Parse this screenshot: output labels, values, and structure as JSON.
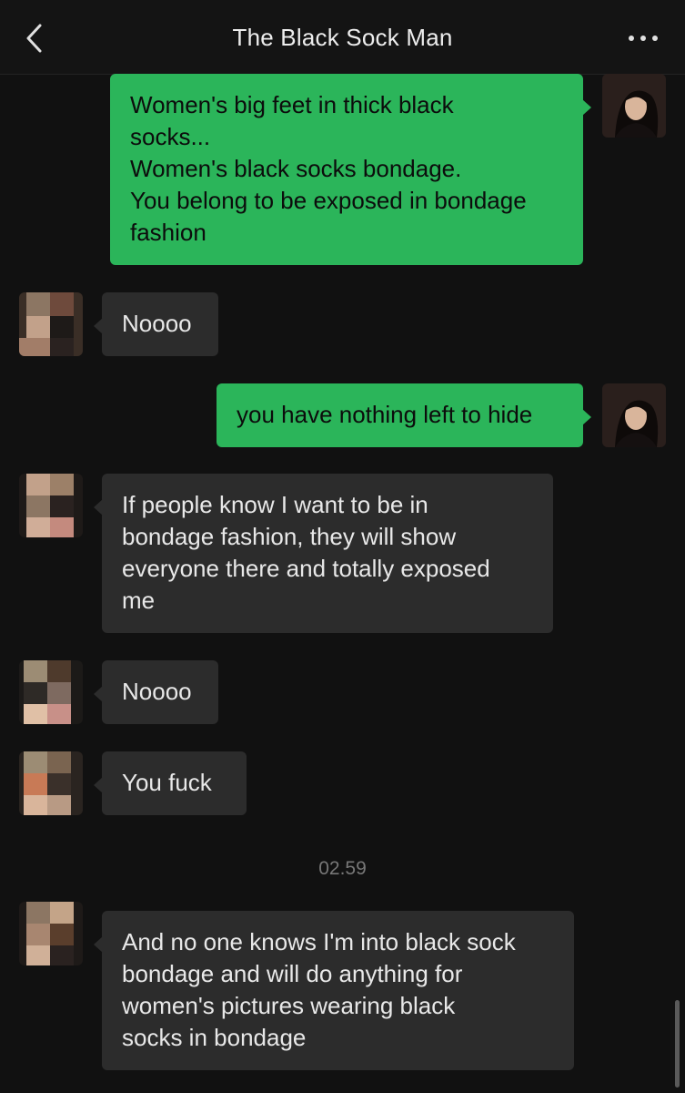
{
  "header": {
    "title": "The Black Sock Man",
    "back_icon": "chevron-left-icon",
    "more_icon": "more-horizontal-icon"
  },
  "colors": {
    "outgoing_bubble": "#2bb55a",
    "incoming_bubble": "#2c2c2c",
    "background": "#111111"
  },
  "messages": [
    {
      "direction": "out",
      "text": "Women's big feet in thick black\nsocks...\nWomen's black socks bondage.\nYou belong to be exposed in bondage\nfashion"
    },
    {
      "direction": "in",
      "text": "Noooo"
    },
    {
      "direction": "out",
      "text": "you have nothing left to hide"
    },
    {
      "direction": "in",
      "text": "If people know I want to be in\nbondage fashion,  they will show\neveryone there and totally exposed\nme"
    },
    {
      "direction": "in",
      "text": "Noooo"
    },
    {
      "direction": "in",
      "text": "You fuck"
    },
    {
      "direction": "in",
      "text": "And no one knows I'm into black sock\nbondage and will do anything for\nwomen's pictures wearing black\nsocks in bondage"
    }
  ],
  "timestamp": "02.59"
}
